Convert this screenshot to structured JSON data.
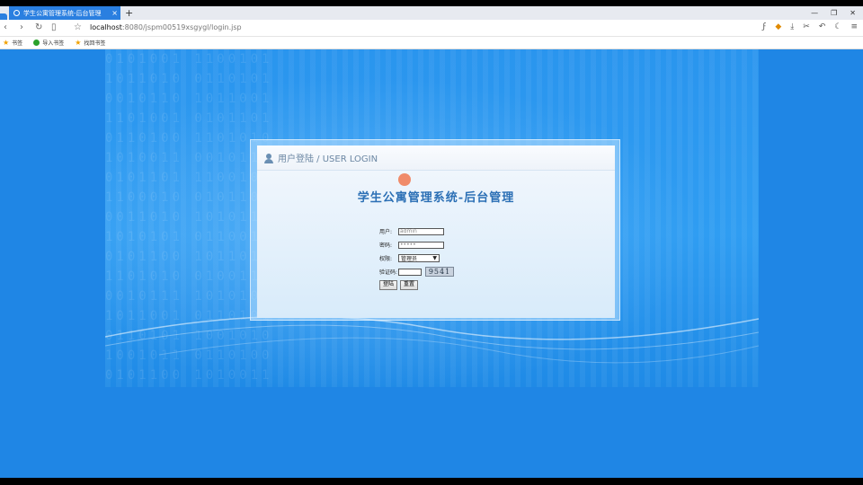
{
  "browser": {
    "tab_title": "学生公寓管理系统-后台管理",
    "tab_close": "×",
    "new_tab": "+",
    "url_host": "localhost",
    "url_path": ":8080/jspm00519xsgygl/login.jsp",
    "icons": [
      "back-icon",
      "forward-icon",
      "refresh-icon",
      "reader-icon",
      "star-icon",
      "download-icon",
      "cut-icon",
      "undo-icon",
      "night-mode-icon",
      "menu-icon"
    ]
  },
  "bookmarks": [
    {
      "label": "书签"
    },
    {
      "label": "导入书签"
    },
    {
      "label": "找回书签"
    }
  ],
  "login": {
    "header_text": "用户登陆 / USER LOGIN",
    "system_title": "学生公寓管理系统-后台管理",
    "username_label": "用户:",
    "username_value": "admin",
    "password_label": "密码:",
    "password_value": "•••••",
    "role_label": "权限:",
    "role_selected": "管理员",
    "captcha_label": "验证码:",
    "captcha_value": "",
    "captcha_image_text": "9541",
    "login_button": "登陆",
    "reset_button": "重置"
  },
  "colors": {
    "page_background": "#1f86e5",
    "tab_active": "#2a7fe0",
    "title_text": "#2b6fb5"
  }
}
